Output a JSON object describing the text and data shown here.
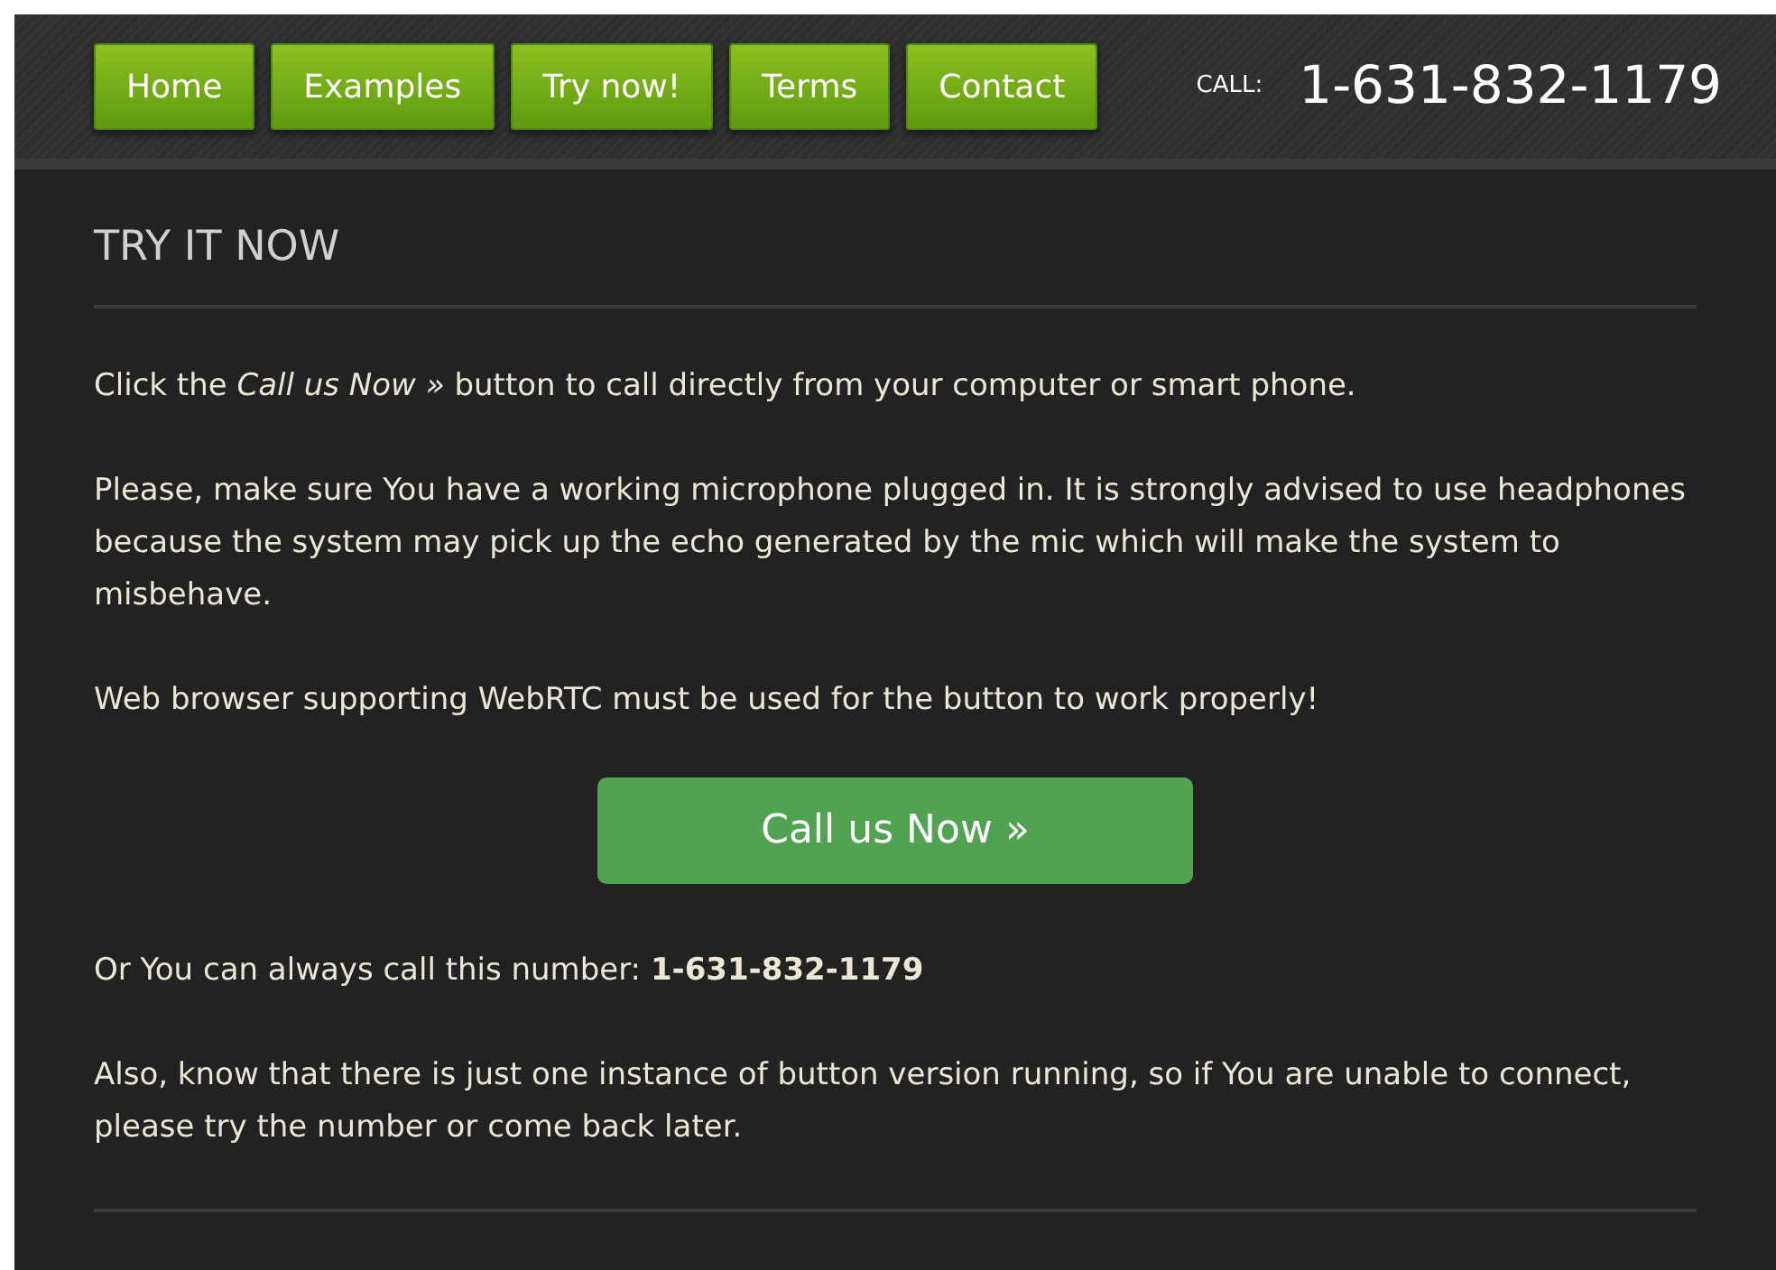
{
  "nav": [
    {
      "label": "Home"
    },
    {
      "label": "Examples"
    },
    {
      "label": "Try now!"
    },
    {
      "label": "Terms"
    },
    {
      "label": "Contact"
    }
  ],
  "call": {
    "label": "CALL:",
    "number": "1-631-832-1179"
  },
  "heading": "TRY IT NOW",
  "intro": "Click the *Call us Now »* button to call directly from your computer or smart phone.",
  "paragraphs": [
    "Please, make sure You have a working microphone plugged in. It is strongly advised to use headphones because the system may pick up the echo generated by the mic which will make the system to misbehave.",
    "Web browser supporting WebRTC must be used for the button to work properly!"
  ],
  "call_button": "Call us Now »",
  "after": [
    "Or You can always call this number: **1-631-832-1179**",
    "Also, know that there is just one instance of button version running, so if You are unable to connect, please try the number or come back later."
  ]
}
